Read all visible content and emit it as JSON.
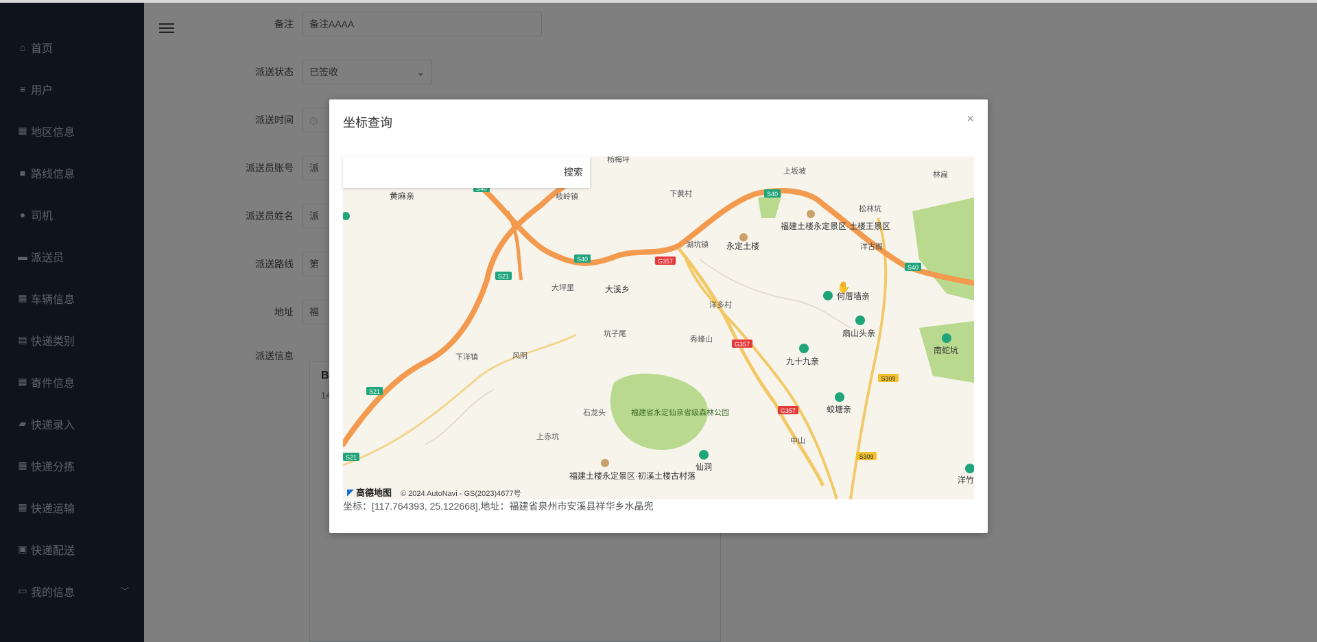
{
  "sidebar": {
    "items": [
      {
        "label": "首页",
        "icon": "home-icon"
      },
      {
        "label": "用户",
        "icon": "list-icon"
      },
      {
        "label": "地区信息",
        "icon": "grid-icon"
      },
      {
        "label": "路线信息",
        "icon": "box-icon"
      },
      {
        "label": "司机",
        "icon": "user-icon"
      },
      {
        "label": "派送员",
        "icon": "monitor-icon"
      },
      {
        "label": "车辆信息",
        "icon": "grid-icon"
      },
      {
        "label": "快递类别",
        "icon": "clipboard-icon"
      },
      {
        "label": "寄件信息",
        "icon": "grid-icon"
      },
      {
        "label": "快递录入",
        "icon": "folder-icon"
      },
      {
        "label": "快递分拣",
        "icon": "grid-icon"
      },
      {
        "label": "快递运输",
        "icon": "grid-icon"
      },
      {
        "label": "快递配送",
        "icon": "briefcase-icon"
      },
      {
        "label": "我的信息",
        "icon": "card-icon"
      }
    ]
  },
  "form": {
    "remark_label": "备注",
    "remark_value": "备注AAAA",
    "status_label": "派送状态",
    "status_value": "已签收",
    "time_label": "派送时间",
    "account_label": "派送员账号",
    "account_value": "派",
    "name_label": "派送员姓名",
    "name_value": "派",
    "route_label": "派送路线",
    "route_value": "第",
    "address_label": "地址",
    "address_value": "福",
    "info_label": "派送信息",
    "card_line1": "B",
    "card_line2": "14"
  },
  "dialog": {
    "title": "坐标查询",
    "close": "×",
    "search_placeholder": "",
    "search_button": "搜索",
    "coord_text": "坐标：[117.764393, 25.122668],地址：福建省泉州市安溪县祥华乡水晶兜",
    "map_logo": "高德地图",
    "map_copyright": "© 2024 AutoNavi - GS(2023)4677号",
    "map_labels": {
      "l1": "黄麻亲",
      "l2": "岐岭镇",
      "l3": "下黄村",
      "l4": "上坂坡",
      "l5": "林扁",
      "l6": "永定土楼",
      "l7": "福建土楼永定景区·土楼王景区",
      "l8": "洋古阁",
      "l9": "大溪乡",
      "l10": "湖坑镇",
      "l11": "何厝墙亲",
      "l12": "扇山头亲",
      "l13": "九十九亲",
      "l14": "南蛇坑",
      "l15": "蛟塘亲",
      "l16": "福建省永定仙亲省级森林公园",
      "l17": "福建土楼永定景区·初溪土楼古村落",
      "l18": "仙洞",
      "l19": "洋竹",
      "l20": "下洋镇",
      "l21": "杨梅坪",
      "l22": "松林坑",
      "l23": "洋多村",
      "l24": "秀峰山",
      "l25": "坑子尾",
      "l26": "中山",
      "l27": "大坪里",
      "l28": "风阴",
      "l29": "石龙头",
      "l30": "上赤坑"
    },
    "road_labels": {
      "s40": "S40",
      "s21": "S21",
      "g357": "G357",
      "s309": "S309"
    }
  },
  "colors": {
    "sidebar_bg": "#1e2738",
    "road_major": "#f39a4e",
    "road_national": "#e5383b",
    "road_provincial": "#20a57a",
    "forest": "#b9d98f"
  }
}
